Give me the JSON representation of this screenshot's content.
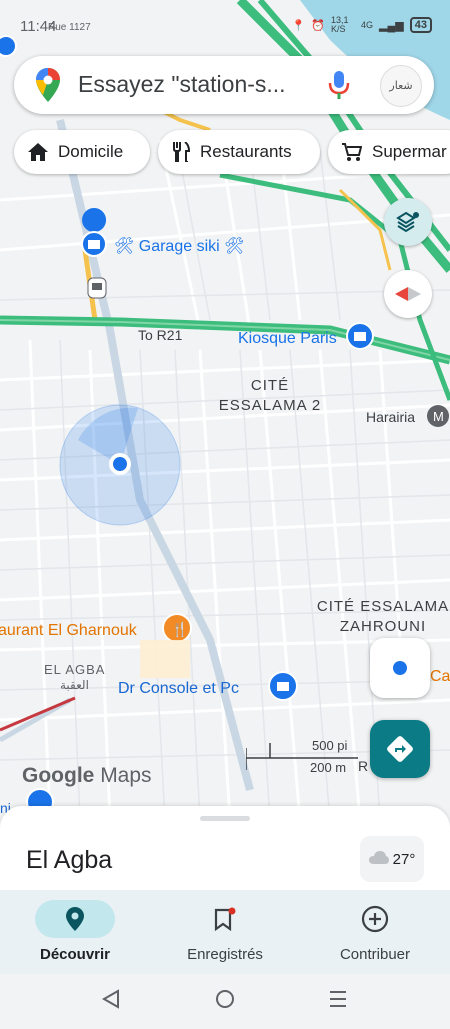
{
  "status": {
    "time": "11:44",
    "network_speed": "13,1 K/S",
    "network_type": "4G",
    "battery": "43"
  },
  "search": {
    "placeholder": "Essayez \"station-s...",
    "avatar_text": "شعار"
  },
  "chips": [
    {
      "label": "Domicile",
      "icon": "home-icon"
    },
    {
      "label": "Restaurants",
      "icon": "restaurant-icon"
    },
    {
      "label": "Supermar",
      "icon": "cart-icon"
    }
  ],
  "map": {
    "labels": {
      "garage": "🛠 Garage siki 🛠",
      "to_r21": "To R21",
      "kiosque": "Kiosque Paris",
      "cite_essalama_2_l1": "CITÉ",
      "cite_essalama_2_l2": "ESSALAMA 2",
      "harairia": "Harairia",
      "cite_zahrouni_l1": "CITÉ ESSALAMA",
      "cite_zahrouni_l2": "ZAHROUNI",
      "restaurant": "aurant El Gharnouk",
      "el_agba": "EL AGBA",
      "el_agba_ar": "العقبة",
      "dr_console": "Dr Console et Pc",
      "ca_partial": "Ca",
      "road_partial": "R",
      "top_partial": "Rue 1127",
      "left_partial": "ni"
    },
    "scale": {
      "imperial": "500 pi",
      "metric": "200 m"
    },
    "logo_google": "Google",
    "logo_maps": "Maps"
  },
  "sheet": {
    "place_name": "El Agba",
    "temperature": "27°"
  },
  "nav": [
    {
      "label": "Découvrir",
      "icon": "explore-pin-icon",
      "active": true
    },
    {
      "label": "Enregistrés",
      "icon": "bookmark-icon",
      "active": false
    },
    {
      "label": "Contribuer",
      "icon": "add-circle-icon",
      "active": false
    }
  ],
  "colors": {
    "highway": "#3dbd7d",
    "water": "#9fd7e8",
    "location": "#1a73e8",
    "accent_teal": "#0b7c86"
  }
}
